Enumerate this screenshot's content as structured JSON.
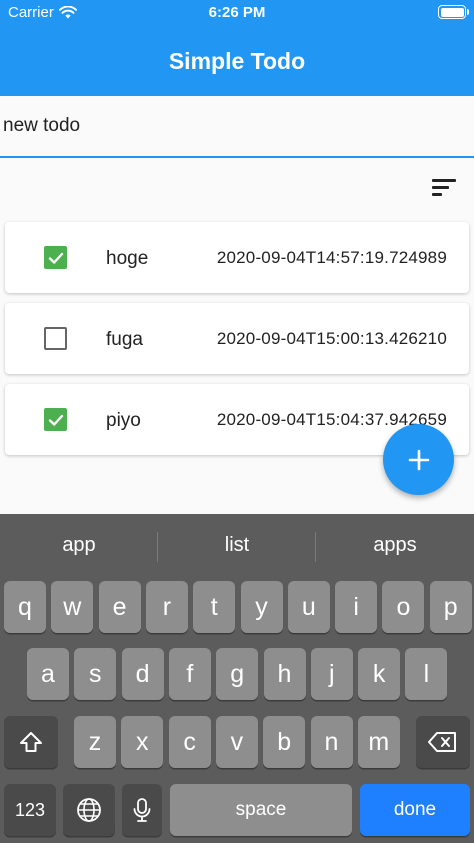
{
  "status": {
    "carrier": "Carrier",
    "time": "6:26 PM"
  },
  "app_title": "Simple Todo",
  "todo_input": {
    "value": "new todo"
  },
  "todos": [
    {
      "name": "hoge",
      "date": "2020-09-04T14:57:19.724989",
      "done": true
    },
    {
      "name": "fuga",
      "date": "2020-09-04T15:00:13.426210",
      "done": false
    },
    {
      "name": "piyo",
      "date": "2020-09-04T15:04:37.942659",
      "done": true
    }
  ],
  "fab_label": "+",
  "keyboard": {
    "suggestions": [
      "app",
      "list",
      "apps"
    ],
    "row1": [
      "q",
      "w",
      "e",
      "r",
      "t",
      "y",
      "u",
      "i",
      "o",
      "p"
    ],
    "row2": [
      "a",
      "s",
      "d",
      "f",
      "g",
      "h",
      "j",
      "k",
      "l"
    ],
    "row3": [
      "z",
      "x",
      "c",
      "v",
      "b",
      "n",
      "m"
    ],
    "numbers_key": "123",
    "space_key": "space",
    "done_key": "done"
  },
  "colors": {
    "primary": "#2196f3",
    "checked": "#4caf50",
    "keyboard_bg": "#5c5c5c",
    "done_key": "#1f80ff"
  }
}
